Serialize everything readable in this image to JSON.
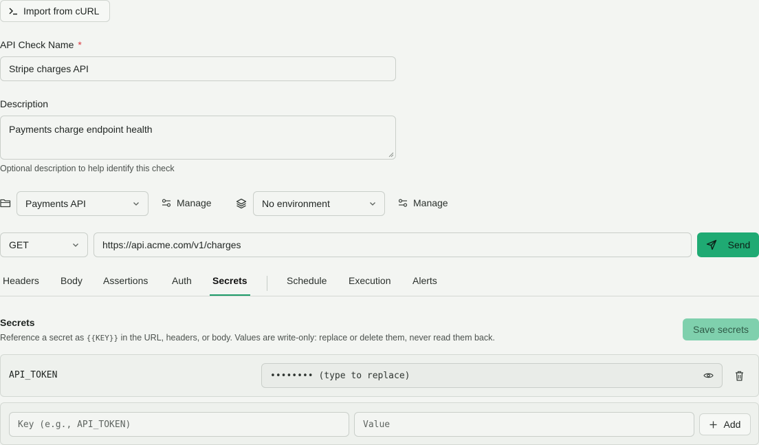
{
  "import_button": {
    "label": "Import from cURL",
    "icon": "terminal-icon"
  },
  "name_field": {
    "label": "API Check Name",
    "required_mark": "*",
    "value": "Stripe charges API"
  },
  "description_field": {
    "label": "Description",
    "value": "Payments charge endpoint health",
    "hint": "Optional description to help identify this check"
  },
  "collection": {
    "selected": "Payments API",
    "manage_label": "Manage"
  },
  "environment": {
    "selected": "No environment",
    "manage_label": "Manage"
  },
  "request": {
    "method": "GET",
    "url": "https://api.acme.com/v1/charges",
    "send_label": "Send"
  },
  "tabs": [
    {
      "label": "Headers"
    },
    {
      "label": "Body"
    },
    {
      "label": "Assertions"
    },
    {
      "label": "Auth"
    },
    {
      "label": "Secrets",
      "active": true
    },
    {
      "label": "Schedule"
    },
    {
      "label": "Execution"
    },
    {
      "label": "Alerts"
    }
  ],
  "secrets": {
    "title": "Secrets",
    "desc_prefix": "Reference a secret as ",
    "desc_code": "{{KEY}}",
    "desc_suffix": " in the URL, headers, or body. Values are write-only: replace or delete them, never read them back.",
    "save_label": "Save secrets",
    "items": [
      {
        "key": "API_TOKEN",
        "value_placeholder": "•••••••• (type to replace)"
      }
    ],
    "new_key_placeholder": "Key (e.g., API_TOKEN)",
    "new_value_placeholder": "Value",
    "add_label": "Add"
  },
  "colors": {
    "accent": "#1faa73",
    "accent_disabled": "#7fd0ad",
    "tab_underline": "#1c9b68",
    "required": "#d9373f"
  }
}
